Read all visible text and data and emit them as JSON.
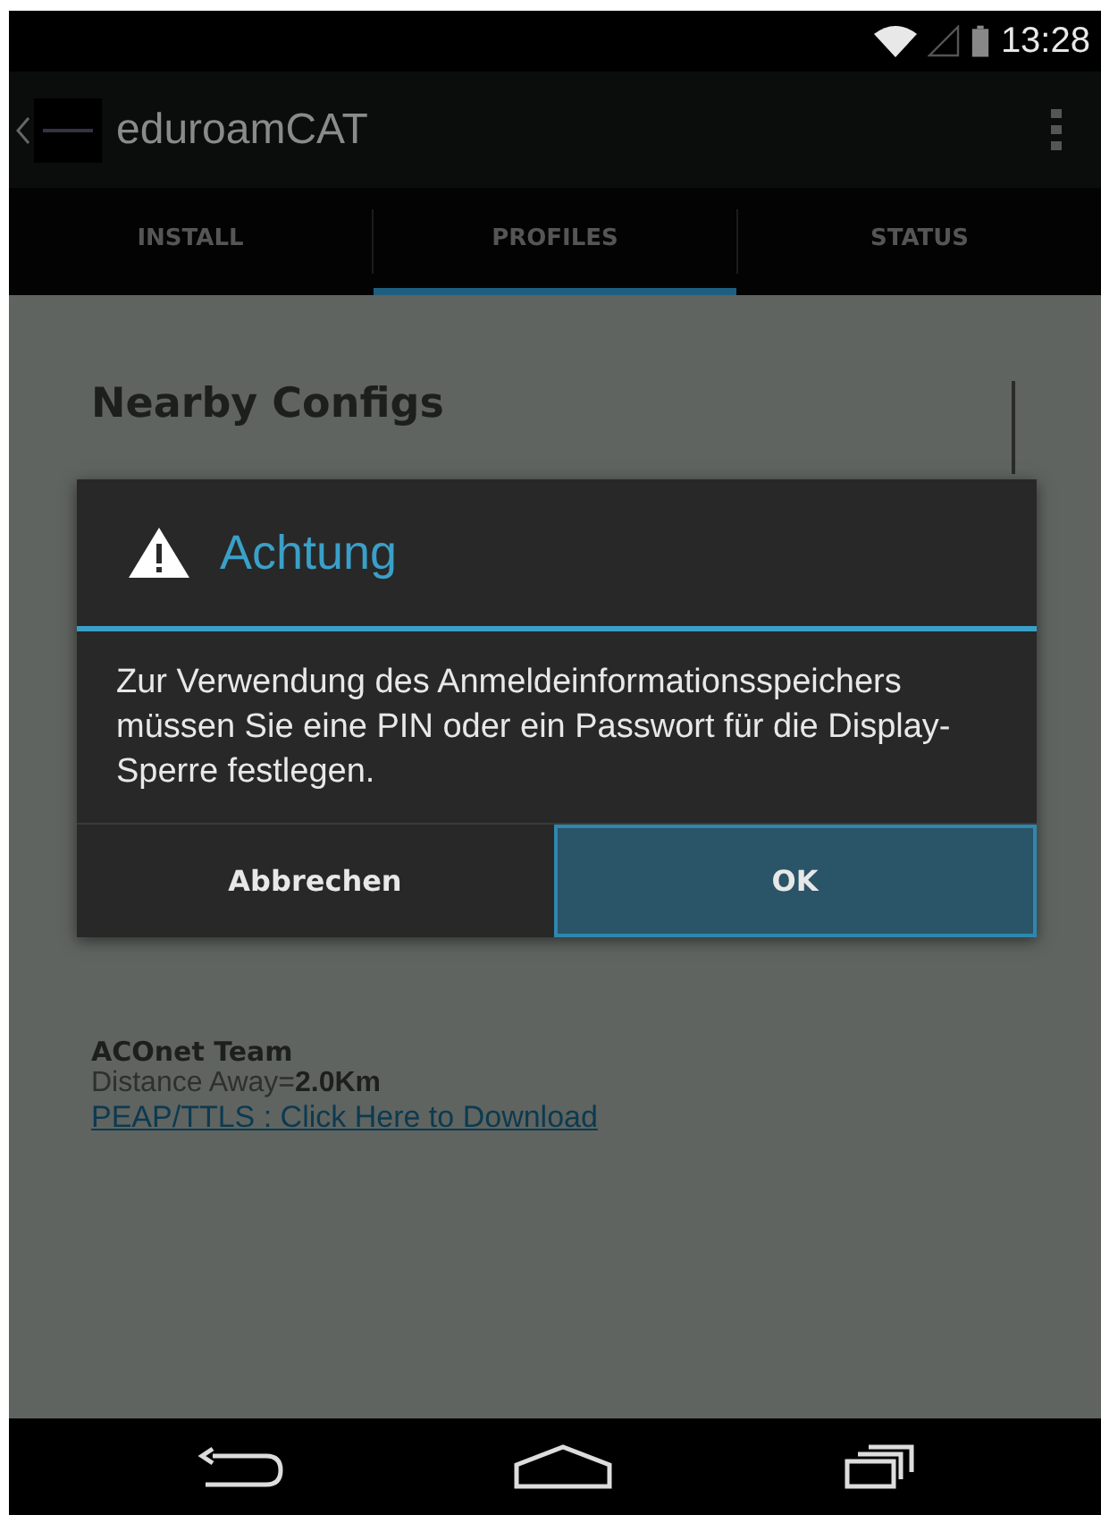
{
  "status_bar": {
    "time": "13:28"
  },
  "action_bar": {
    "title": "eduroamCAT"
  },
  "tabs": [
    {
      "label": "INSTALL",
      "selected": false
    },
    {
      "label": "PROFILES",
      "selected": true
    },
    {
      "label": "STATUS",
      "selected": false
    }
  ],
  "content": {
    "heading": "Nearby Configs",
    "configs": [
      {
        "name": "ACOnet Team",
        "distance": "Distance Away=**2.0Km**",
        "link": "PEAP/TTLS : Click Here to Download"
      }
    ]
  },
  "dialog": {
    "title": "Achtung",
    "message": "Zur Verwendung des Anmeldeinformationsspeichers müssen Sie eine PIN oder ein Passwort für die Display-Sperre festlegen.",
    "buttons": [
      {
        "label": "Abbrechen",
        "selected": false
      },
      {
        "label": "OK",
        "selected": true
      }
    ]
  }
}
